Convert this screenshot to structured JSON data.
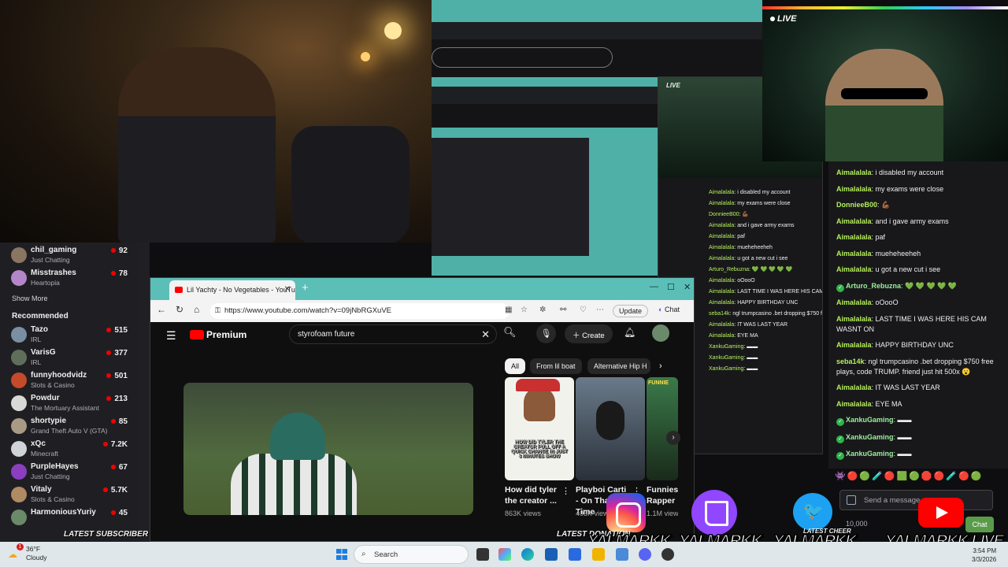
{
  "sidebar": {
    "followed": [
      {
        "name": "chil_gaming",
        "category": "Just Chatting",
        "viewers": "92",
        "color": "#8a7560"
      },
      {
        "name": "Misstrashes",
        "category": "Heartopia",
        "viewers": "78",
        "color": "#b486c9"
      }
    ],
    "show_more": "Show More",
    "recommended_title": "Recommended",
    "recommended": [
      {
        "name": "Tazo",
        "category": "IRL",
        "viewers": "515",
        "color": "#7a8fa3"
      },
      {
        "name": "VarisG",
        "category": "IRL",
        "viewers": "377",
        "color": "#5f6e5a"
      },
      {
        "name": "funnyhoodvidz",
        "category": "Slots & Casino",
        "viewers": "501",
        "color": "#c44a2a"
      },
      {
        "name": "Powdur",
        "category": "The Mortuary Assistant",
        "viewers": "213",
        "color": "#d8d8d8"
      },
      {
        "name": "shortypie",
        "category": "Grand Theft Auto V (GTA)",
        "viewers": "85",
        "color": "#a99a86"
      },
      {
        "name": "xQc",
        "category": "Minecraft",
        "viewers": "7.2K",
        "color": "#cfd3d8"
      },
      {
        "name": "PurpleHayes",
        "category": "Just Chatting",
        "viewers": "67",
        "color": "#8b3fc0"
      },
      {
        "name": "Vitaly",
        "category": "Slots & Casino",
        "viewers": "5.7K",
        "color": "#b08a62"
      },
      {
        "name": "HarmoniousYuriy",
        "category": "",
        "viewers": "45",
        "color": "#6a8a6a"
      }
    ]
  },
  "browser": {
    "tab_title": "Lil Yachty - No Vegetables - YouTu",
    "url": "https://www.youtube.com/watch?v=09jNbRGXuVE",
    "update_label": "Update",
    "chat_label": "Chat"
  },
  "youtube": {
    "logo_text": "Premium",
    "search_value": "styrofoam future",
    "create_label": "Create",
    "chips": [
      "All",
      "From lil boat",
      "Alternative Hip H"
    ],
    "shorts": [
      {
        "title": "How did tyler the creator ...",
        "views": "863K views",
        "overlay": "HOW DID TYLER THE CREATOR PULL OFF A QUICK CHANGE IN JUST 3 MINUTES SHOW"
      },
      {
        "title": "Playboi Carti - On That Time",
        "views": "403K views",
        "overlay": ""
      },
      {
        "title": "Funnies Rapper",
        "views": "1.1M views",
        "overlay": "FUNNIE"
      }
    ]
  },
  "webcam": {
    "live_label": "LIVE"
  },
  "chat": {
    "messages": [
      {
        "user": "Aimalalala",
        "text": "i disabled my account",
        "verified": false
      },
      {
        "user": "Aimalalala",
        "text": "my exams were close",
        "verified": false
      },
      {
        "user": "DonnieeB00",
        "text": "💪🏾",
        "verified": false
      },
      {
        "user": "Aimalalala",
        "text": "and i gave army exams",
        "verified": false
      },
      {
        "user": "Aimalalala",
        "text": "paf",
        "verified": false
      },
      {
        "user": "Aimalalala",
        "text": "mueheheeheh",
        "verified": false
      },
      {
        "user": "Aimalalala",
        "text": "u got a new cut i see",
        "verified": false
      },
      {
        "user": "Arturo_Rebuzna",
        "text": "💚 💚 💚 💚 💚",
        "verified": true
      },
      {
        "user": "Aimalalala",
        "text": "oOooO",
        "verified": false
      },
      {
        "user": "Aimalalala",
        "text": "LAST TIME I WAS HERE HIS CAM WASNT ON",
        "verified": false
      },
      {
        "user": "Aimalalala",
        "text": "HAPPY BIRTHDAY UNC",
        "verified": false
      },
      {
        "user": "seba14k",
        "text": "ngl trumpcasino .bet dropping $750 free plays, code TRUMP. friend just hit 500x 😮",
        "verified": false
      },
      {
        "user": "Aimalalala",
        "text": "IT WAS LAST YEAR",
        "verified": false
      },
      {
        "user": "Aimalalala",
        "text": "EYE MA",
        "verified": false
      },
      {
        "user": "XankuGaming",
        "text": "▬▬",
        "verified": true
      },
      {
        "user": "XankuGaming",
        "text": "▬▬",
        "verified": true
      },
      {
        "user": "XankuGaming",
        "text": "▬▬",
        "verified": true
      }
    ],
    "input_placeholder": "Send a message",
    "bits": "10,000",
    "chat_button": "Chat"
  },
  "overlay": {
    "latest_subscriber": "LATEST SUBSCRIBER",
    "latest_donation": "LATEST DONATION",
    "latest_cheer": "LATEST CHEER",
    "handles": [
      "YALMARKK",
      "YALMARKK",
      "YALMARKK",
      "YALMARKK LIVE"
    ]
  },
  "taskbar": {
    "temp": "36°F",
    "condition": "Cloudy",
    "notification_count": "1",
    "search_label": "Search",
    "date": "3/3/2026",
    "time": "3:54 PM"
  }
}
